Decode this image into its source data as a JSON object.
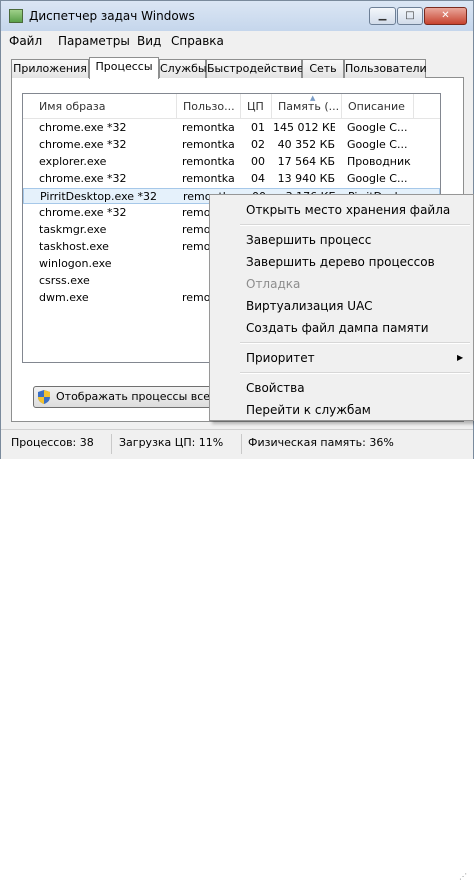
{
  "window": {
    "title": "Диспетчер задач Windows",
    "min_glyph": "▁",
    "max_glyph": "□",
    "close_glyph": "✕"
  },
  "menu": [
    "Файл",
    "Параметры",
    "Вид",
    "Справка"
  ],
  "tabs": [
    "Приложения",
    "Процессы",
    "Службы",
    "Быстродействие",
    "Сеть",
    "Пользователи"
  ],
  "active_tab": "Процессы",
  "columns": [
    "Имя образа",
    "Пользо...",
    "ЦП",
    "Память (...",
    "Описание"
  ],
  "sort_glyph": "▲",
  "processes": [
    {
      "name": "chrome.exe *32",
      "user": "remontka",
      "cpu": "01",
      "mem": "145 012 КБ",
      "desc": "Google C..."
    },
    {
      "name": "chrome.exe *32",
      "user": "remontka",
      "cpu": "02",
      "mem": "40 352 КБ",
      "desc": "Google C..."
    },
    {
      "name": "explorer.exe",
      "user": "remontka",
      "cpu": "00",
      "mem": "17 564 КБ",
      "desc": "Проводник"
    },
    {
      "name": "chrome.exe *32",
      "user": "remontka",
      "cpu": "04",
      "mem": "13 940 КБ",
      "desc": "Google C..."
    },
    {
      "name": "PirritDesktop.exe *32",
      "user": "remontka",
      "cpu": "00",
      "mem": "3 176 КБ",
      "desc": "PirritDesk..."
    },
    {
      "name": "chrome.exe *32",
      "user": "remon",
      "cpu": "",
      "mem": "",
      "desc": ""
    },
    {
      "name": "taskmgr.exe",
      "user": "remon",
      "cpu": "",
      "mem": "",
      "desc": ""
    },
    {
      "name": "taskhost.exe",
      "user": "remon",
      "cpu": "",
      "mem": "",
      "desc": ""
    },
    {
      "name": "winlogon.exe",
      "user": "",
      "cpu": "",
      "mem": "",
      "desc": ""
    },
    {
      "name": "csrss.exe",
      "user": "",
      "cpu": "",
      "mem": "",
      "desc": ""
    },
    {
      "name": "dwm.exe",
      "user": "remon",
      "cpu": "",
      "mem": "",
      "desc": ""
    }
  ],
  "selected_index": 4,
  "show_all_button": "Отображать процессы всех по",
  "status": {
    "processes": "Процессов: 38",
    "cpu": "Загрузка ЦП: 11%",
    "memory": "Физическая память: 36%"
  },
  "context_menu": {
    "items": [
      {
        "label": "Открыть место хранения файла",
        "disabled": false
      },
      {
        "separator": true
      },
      {
        "label": "Завершить процесс",
        "disabled": false
      },
      {
        "label": "Завершить дерево процессов",
        "disabled": false
      },
      {
        "label": "Отладка",
        "disabled": true
      },
      {
        "label": "Виртуализация UAC",
        "disabled": false
      },
      {
        "label": "Создать файл дампа памяти",
        "disabled": false
      },
      {
        "separator": true
      },
      {
        "label": "Приоритет",
        "disabled": false,
        "submenu": true
      },
      {
        "separator": true
      },
      {
        "label": "Свойства",
        "disabled": false
      },
      {
        "label": "Перейти к службам",
        "disabled": false
      }
    ],
    "submenu_glyph": "▶"
  },
  "colors": {
    "selection": "#e5f1fb",
    "selection_border": "#a6c8e9",
    "disabled_text": "#8d8d8d"
  }
}
